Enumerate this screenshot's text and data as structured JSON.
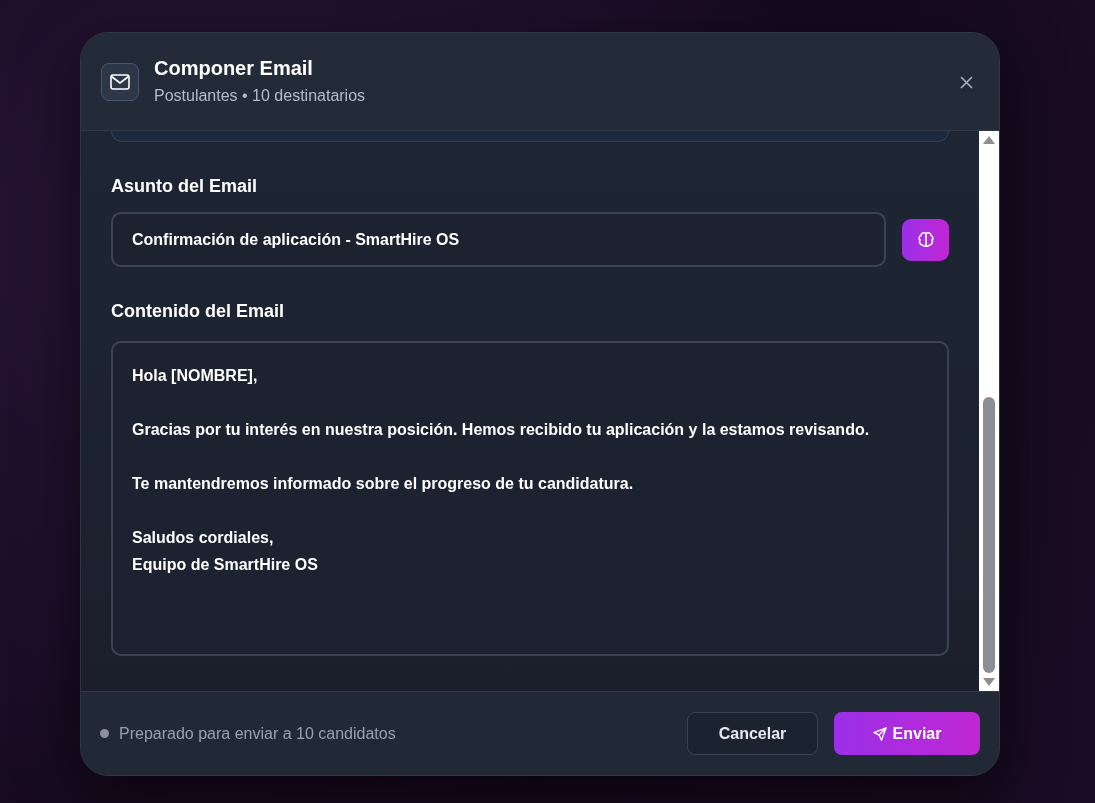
{
  "dialog": {
    "title": "Componer Email",
    "subtitle": "Postulantes • 10 destinatarios"
  },
  "subject": {
    "label": "Asunto del Email",
    "value": "Confirmación de aplicación - SmartHire OS"
  },
  "content": {
    "label": "Contenido del Email",
    "value": "Hola [NOMBRE],\n\nGracias por tu interés en nuestra posición. Hemos recibido tu aplicación y la estamos revisando.\n\nTe mantendremos informado sobre el progreso de tu candidatura.\n\nSaludos cordiales,\nEquipo de SmartHire OS"
  },
  "footer": {
    "status": "Preparado para enviar a 10 candidatos",
    "buttons": [
      {
        "kind": "secondary",
        "label": "Cancelar"
      },
      {
        "kind": "primary",
        "label": "Enviar"
      }
    ]
  }
}
